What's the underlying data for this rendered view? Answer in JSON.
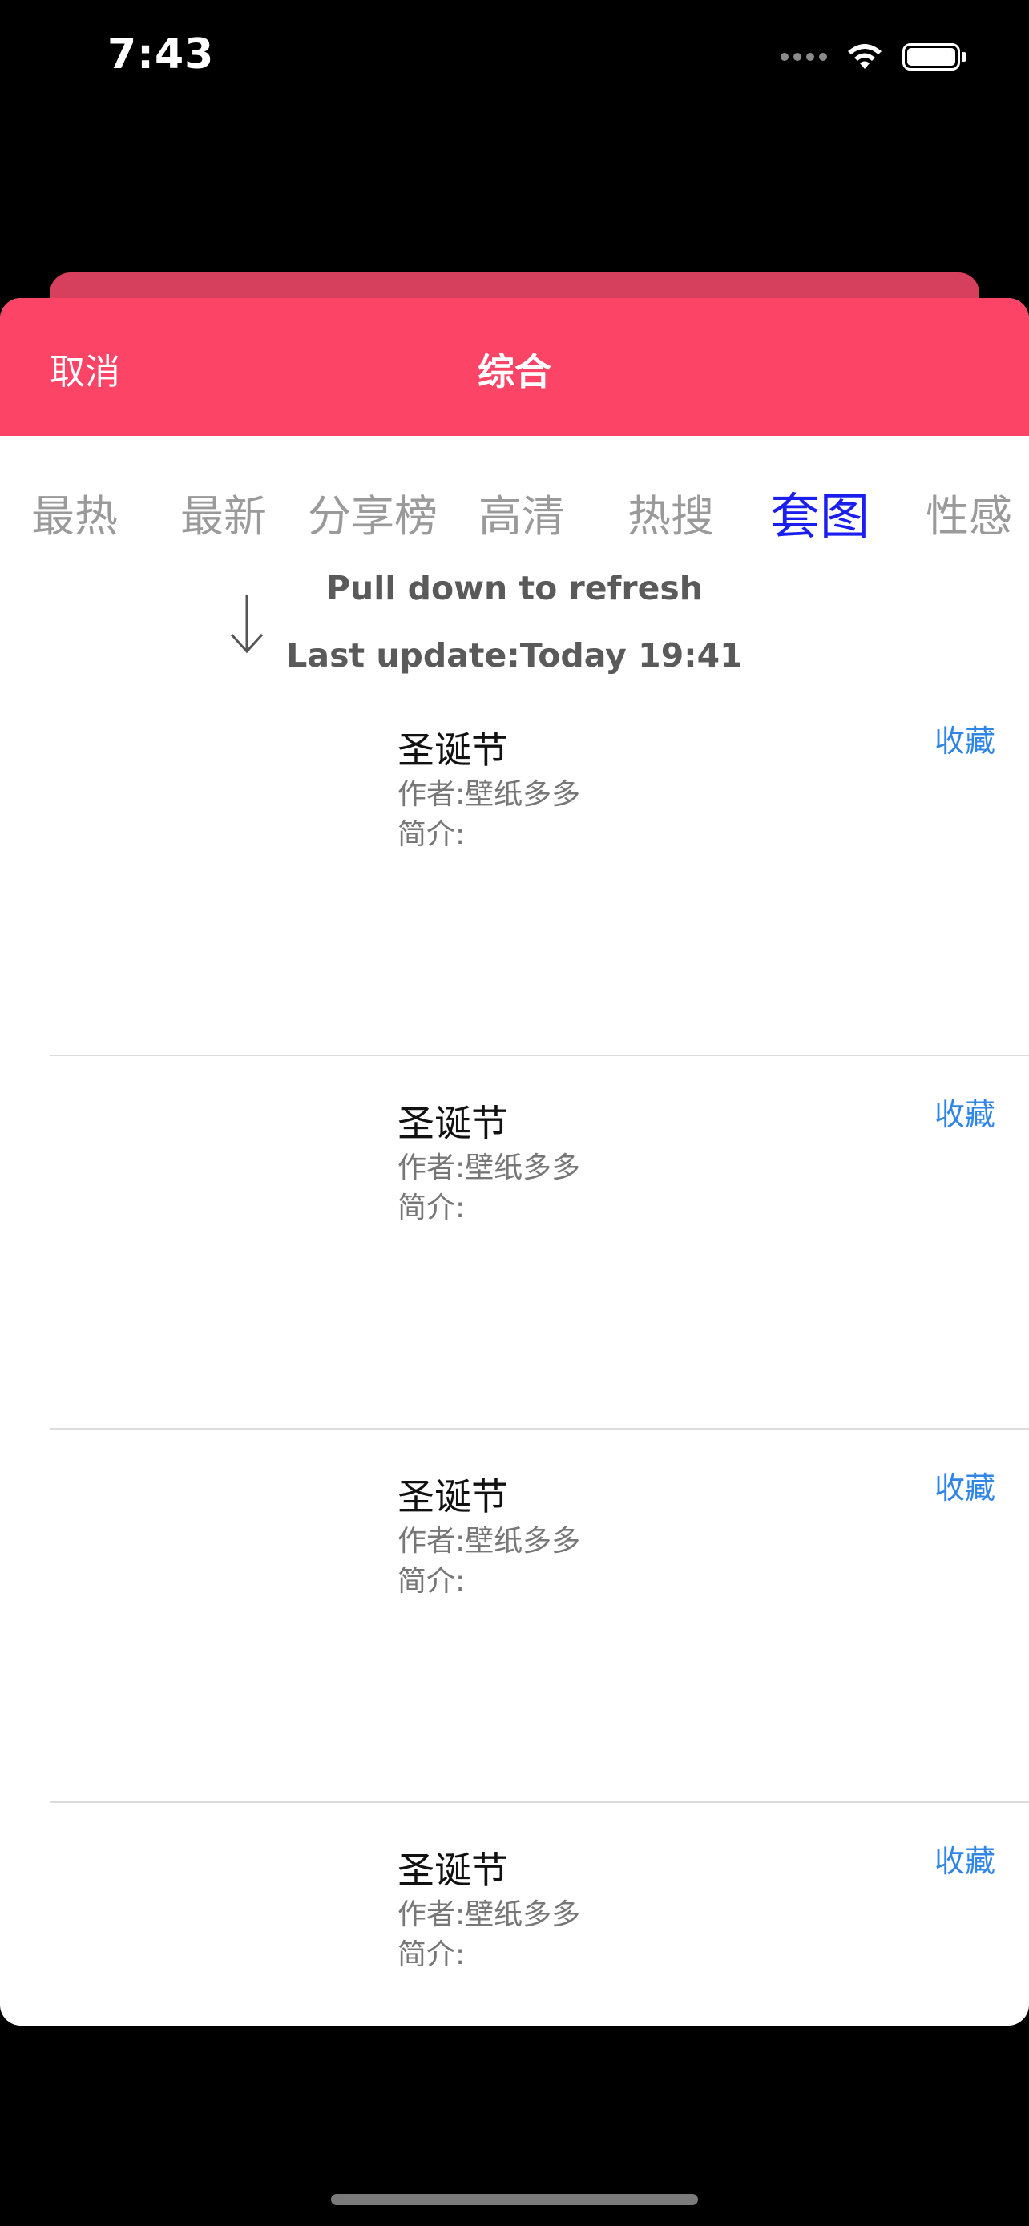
{
  "status_bar": {
    "time": "7:43",
    "icons": [
      "signal-dots-icon",
      "wifi-icon",
      "battery-icon"
    ]
  },
  "colors": {
    "header_background": "#fb4466",
    "active_tab": "#1a1ff0",
    "inactive_tab": "#9a9a9a",
    "favorite_link": "#2f86e6"
  },
  "header": {
    "cancel_label": "取消",
    "title": "综合"
  },
  "tabs": [
    {
      "label": "最热",
      "active": false
    },
    {
      "label": "最新",
      "active": false
    },
    {
      "label": "分享榜",
      "active": false
    },
    {
      "label": "高清",
      "active": false
    },
    {
      "label": "热搜",
      "active": false
    },
    {
      "label": "套图",
      "active": true
    },
    {
      "label": "性感",
      "active": false
    }
  ],
  "refresh": {
    "arrow_icon": "arrow-down-icon",
    "pull_text": "Pull down to refresh",
    "last_update": "Last update:Today 19:41"
  },
  "items": [
    {
      "title": "圣诞节",
      "author": "作者:壁纸多多",
      "intro": "简介:",
      "favorite_label": "收藏"
    },
    {
      "title": "圣诞节",
      "author": "作者:壁纸多多",
      "intro": "简介:",
      "favorite_label": "收藏"
    },
    {
      "title": "圣诞节",
      "author": "作者:壁纸多多",
      "intro": "简介:",
      "favorite_label": "收藏"
    },
    {
      "title": "圣诞节",
      "author": "作者:壁纸多多",
      "intro": "简介:",
      "favorite_label": "收藏"
    }
  ]
}
